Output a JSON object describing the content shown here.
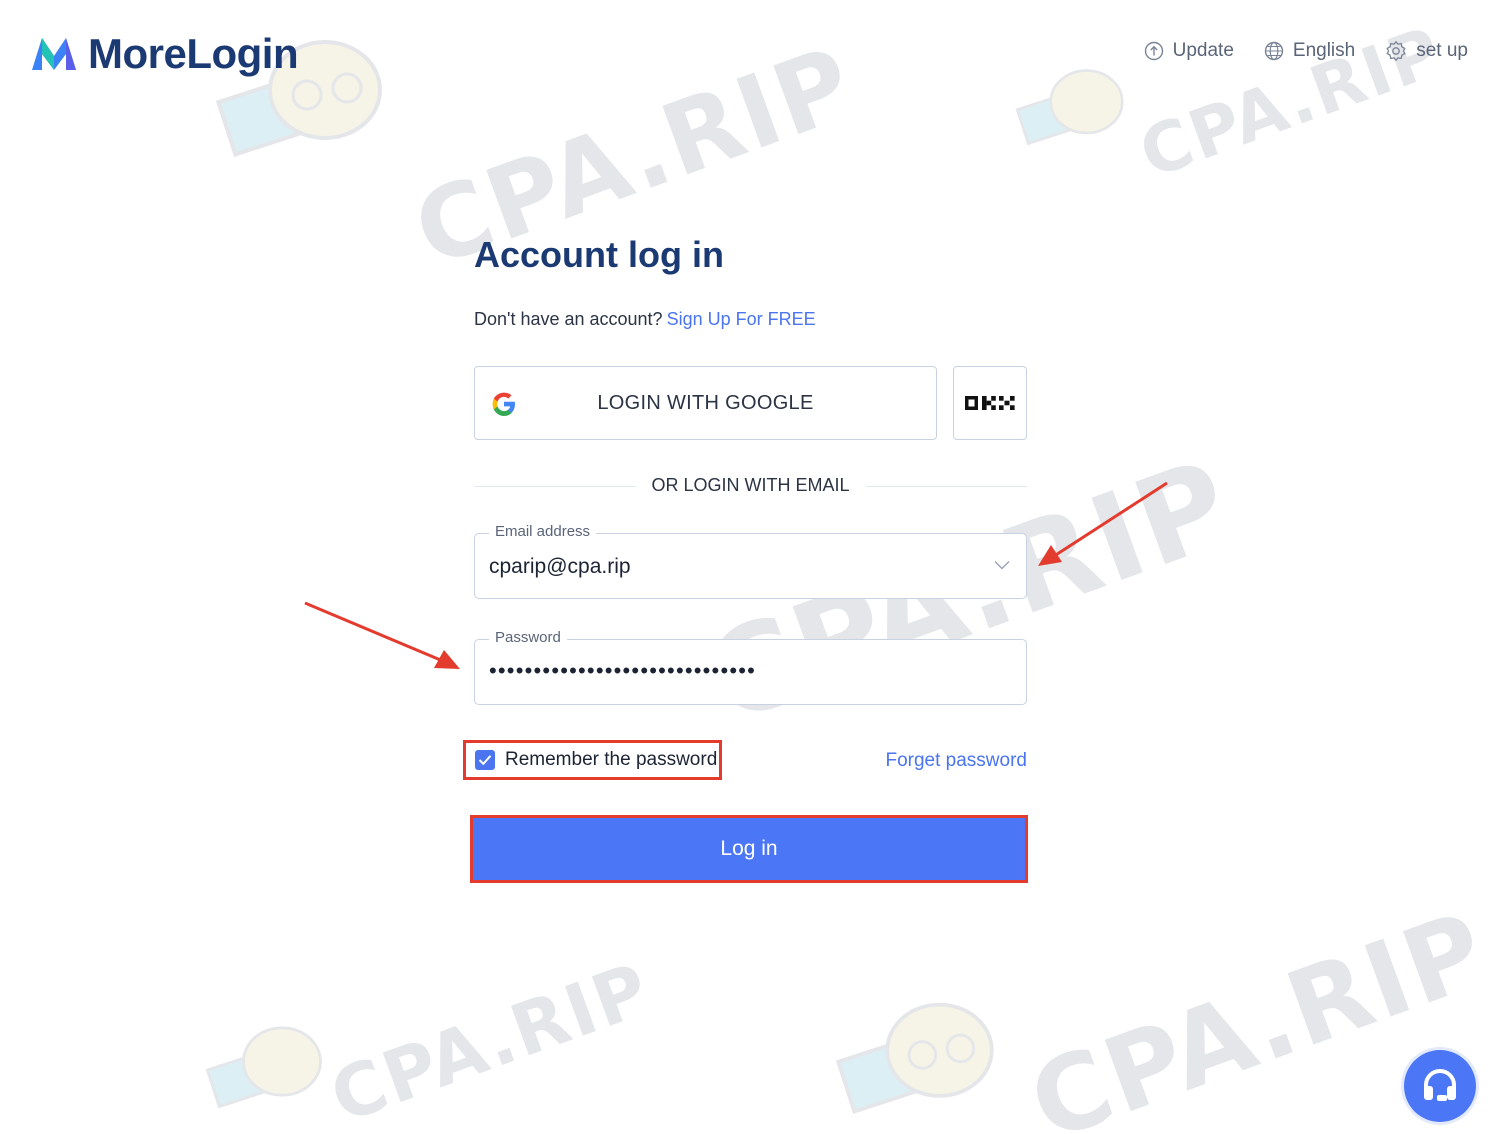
{
  "header": {
    "brand": "MoreLogin",
    "nav": [
      {
        "label": "Update",
        "icon": "update-icon"
      },
      {
        "label": "English",
        "icon": "globe-icon"
      },
      {
        "label": "set up",
        "icon": "gear-icon"
      }
    ]
  },
  "form": {
    "title": "Account log in",
    "signup_prompt": "Don't have an account?",
    "signup_link": "Sign Up For FREE",
    "google_button": "LOGIN WITH GOOGLE",
    "okx_button": "OKX",
    "divider": "OR LOGIN WITH EMAIL",
    "email": {
      "label": "Email address",
      "value": "cparip@cpa.rip"
    },
    "password": {
      "label": "Password",
      "masked": "••••••••••••••••••••••••••••••"
    },
    "remember_label": "Remember the password",
    "remember_checked": true,
    "forget_link": "Forget password",
    "submit": "Log in"
  },
  "watermark": "CPA.RIP",
  "colors": {
    "brand": "#1b3a73",
    "accent": "#4b76f6",
    "annotation": "#e33b2e"
  }
}
